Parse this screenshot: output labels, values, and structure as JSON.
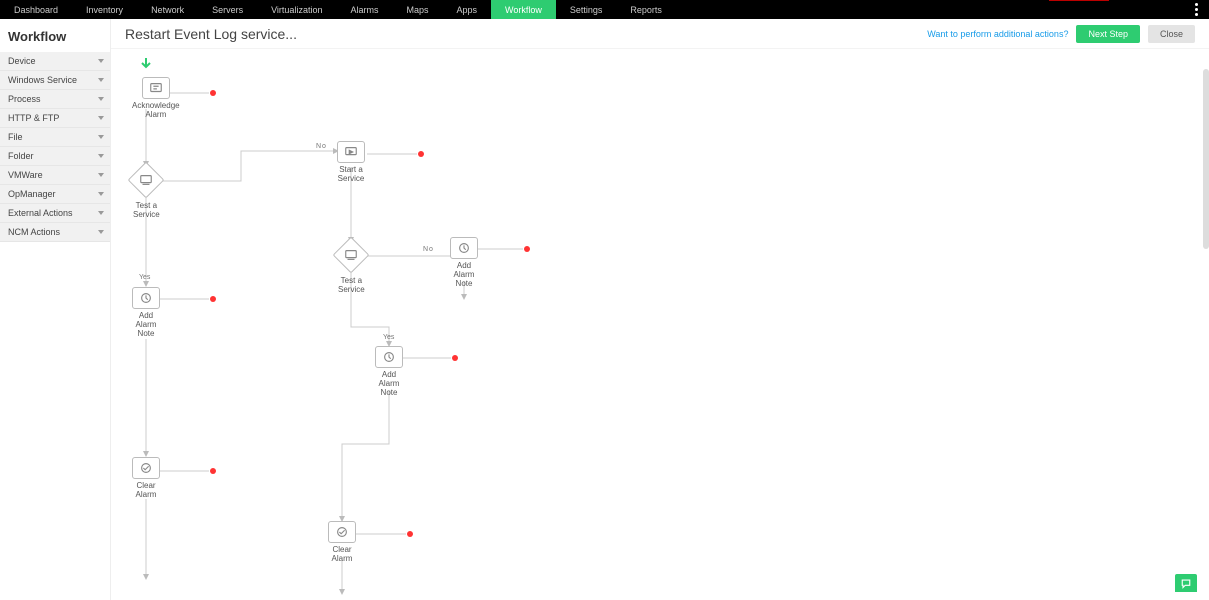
{
  "nav": {
    "tabs": [
      "Dashboard",
      "Inventory",
      "Network",
      "Servers",
      "Virtualization",
      "Alarms",
      "Maps",
      "Apps",
      "Workflow",
      "Settings",
      "Reports"
    ],
    "active": "Workflow"
  },
  "sidebar": {
    "title": "Workflow",
    "items": [
      "Device",
      "Windows Service",
      "Process",
      "HTTP & FTP",
      "File",
      "Folder",
      "VMWare",
      "OpManager",
      "External Actions",
      "NCM Actions"
    ]
  },
  "page": {
    "title": "Restart Event Log service...",
    "hint": "Want to perform additional actions?",
    "nextStep": "Next Step",
    "close": "Close"
  },
  "nodes": {
    "ackAlarm": "Acknowledge\nAlarm",
    "testService1": "Test a\nService",
    "startService": "Start a\nService",
    "testService2": "Test a\nService",
    "addNote1": "Add\nAlarm\nNote",
    "addNote2": "Add\nAlarm\nNote",
    "addNote3": "Add\nAlarm\nNote",
    "clearAlarm1": "Clear\nAlarm",
    "clearAlarm2": "Clear\nAlarm"
  },
  "labels": {
    "yes": "Yes",
    "no": "No"
  }
}
